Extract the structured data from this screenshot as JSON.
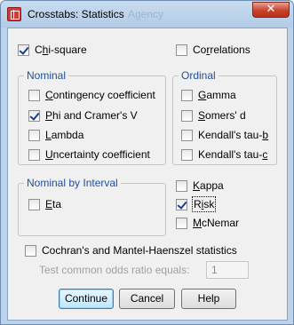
{
  "window": {
    "title": "Crosstabs: Statistics",
    "background_title": "Agency",
    "close_symbol": "✕"
  },
  "top": {
    "chi_square": {
      "label": "Chi-square",
      "mnemonic": "h",
      "checked": true
    },
    "correlations": {
      "label": "Correlations",
      "mnemonic": "r",
      "checked": false
    }
  },
  "nominal": {
    "title": "Nominal",
    "items": [
      {
        "label": "Contingency coefficient",
        "mnemonic": "C",
        "checked": false
      },
      {
        "label": "Phi and Cramer's V",
        "mnemonic": "P",
        "checked": true
      },
      {
        "label": "Lambda",
        "mnemonic": "L",
        "checked": false
      },
      {
        "label": "Uncertainty coefficient",
        "mnemonic": "U",
        "checked": false
      }
    ]
  },
  "ordinal": {
    "title": "Ordinal",
    "items": [
      {
        "label": "Gamma",
        "mnemonic": "G",
        "checked": false
      },
      {
        "label": "Somers' d",
        "mnemonic": "S",
        "checked": false
      },
      {
        "label": "Kendall's tau-b",
        "mnemonic": "b",
        "checked": false
      },
      {
        "label": "Kendall's tau-c",
        "mnemonic": "c",
        "checked": false
      }
    ]
  },
  "nominal_by_interval": {
    "title": "Nominal by Interval",
    "eta": {
      "label": "Eta",
      "mnemonic": "E",
      "checked": false
    }
  },
  "other": [
    {
      "label": "Kappa",
      "mnemonic": "K",
      "checked": false
    },
    {
      "label": "Risk",
      "mnemonic": "i",
      "checked": true
    },
    {
      "label": "McNemar",
      "mnemonic": "M",
      "checked": false
    }
  ],
  "cochran": {
    "label": "Cochran's and Mantel-Haenszel statistics",
    "mnemonic": "A",
    "checked": false
  },
  "odds": {
    "label": "Test common odds ratio equals:",
    "value": "1"
  },
  "buttons": {
    "continue": "Continue",
    "cancel": "Cancel",
    "help": "Help"
  },
  "colors": {
    "group_title": "#1f4e9c",
    "title_bar": "#bcd3ea",
    "close_button": "#c9422c"
  }
}
